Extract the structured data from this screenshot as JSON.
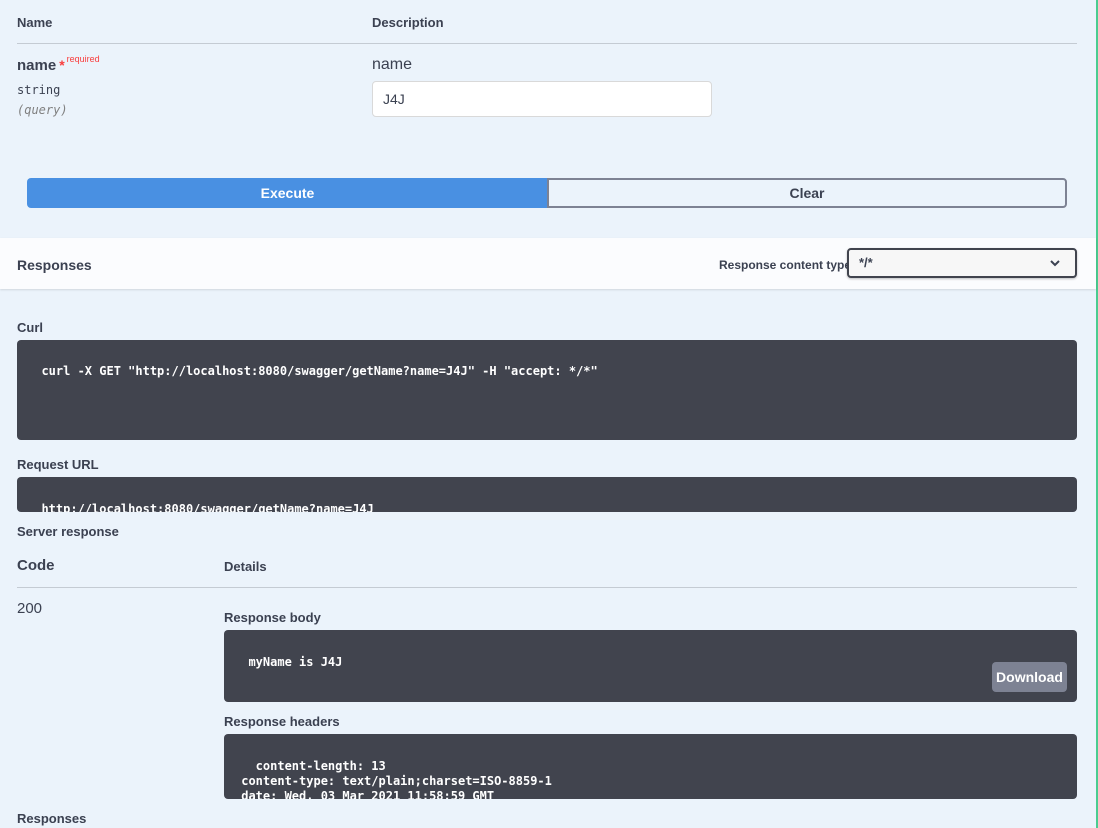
{
  "params": {
    "col_name": "Name",
    "col_description": "Description",
    "items": [
      {
        "name": "name",
        "required_star": "*",
        "required_label": "required",
        "type": "string",
        "in": "(query)",
        "description": "name",
        "value": "J4J"
      }
    ]
  },
  "actions": {
    "execute_label": "Execute",
    "clear_label": "Clear"
  },
  "responses_bar": {
    "title": "Responses",
    "content_type_label": "Response content type",
    "content_type_value": "*/*"
  },
  "curl": {
    "label": "Curl",
    "command": "curl -X GET \"http://localhost:8080/swagger/getName?name=J4J\" -H \"accept: */*\""
  },
  "request_url": {
    "label": "Request URL",
    "value": "http://localhost:8080/swagger/getName?name=J4J"
  },
  "server_response": {
    "label": "Server response",
    "col_code": "Code",
    "col_details": "Details",
    "code": "200",
    "body_label": "Response body",
    "body": "myName is J4J",
    "download_label": "Download",
    "headers_label": "Response headers",
    "headers": " content-length: 13 \n content-type: text/plain;charset=ISO-8859-1 \n date: Wed, 03 Mar 2021 11:58:59 GMT "
  },
  "footer": {
    "responses_label": "Responses"
  },
  "colors": {
    "page_bg": "#ebf3fb",
    "execute": "#4990e2",
    "code_bg": "#41444e",
    "required": "#f93e3e",
    "accent_edge": "#49cc90"
  }
}
